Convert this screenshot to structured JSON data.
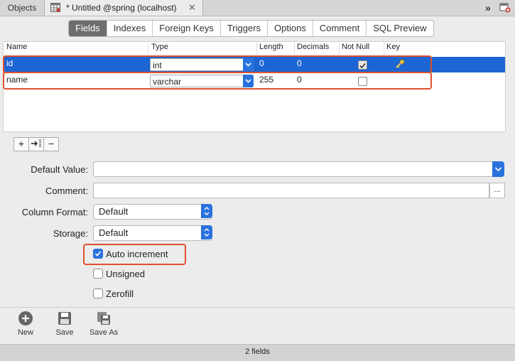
{
  "tabs": {
    "objects_label": "Objects",
    "document_title": "* Untitled @spring (localhost)",
    "close_glyph": "✕",
    "overflow_glyph": "»"
  },
  "segments": [
    "Fields",
    "Indexes",
    "Foreign Keys",
    "Triggers",
    "Options",
    "Comment",
    "SQL Preview"
  ],
  "active_segment": "Fields",
  "table": {
    "columns": [
      "Name",
      "Type",
      "Length",
      "Decimals",
      "Not Null",
      "Key"
    ],
    "rows": [
      {
        "name": "id",
        "type": "int",
        "length": "0",
        "decimals": "0",
        "not_null": true,
        "key": "key-icon",
        "selected": true
      },
      {
        "name": "name",
        "type": "varchar",
        "length": "255",
        "decimals": "0",
        "not_null": false,
        "key": "",
        "selected": false
      }
    ]
  },
  "row_buttons": {
    "add": "+",
    "insert": "→",
    "remove": "−"
  },
  "form": {
    "default_value_label": "Default Value:",
    "default_value": "",
    "comment_label": "Comment:",
    "comment_value": "",
    "comment_button": "...",
    "column_format_label": "Column Format:",
    "column_format_value": "Default",
    "storage_label": "Storage:",
    "storage_value": "Default",
    "options": [
      {
        "label": "Auto increment",
        "checked": true
      },
      {
        "label": "Unsigned",
        "checked": false
      },
      {
        "label": "Zerofill",
        "checked": false
      }
    ]
  },
  "toolbar": {
    "new": "New",
    "save": "Save",
    "save_as": "Save As"
  },
  "status": "2 fields",
  "colors": {
    "selection": "#1c65d2",
    "accent": "#2a72dd",
    "highlight": "#e0502c"
  }
}
